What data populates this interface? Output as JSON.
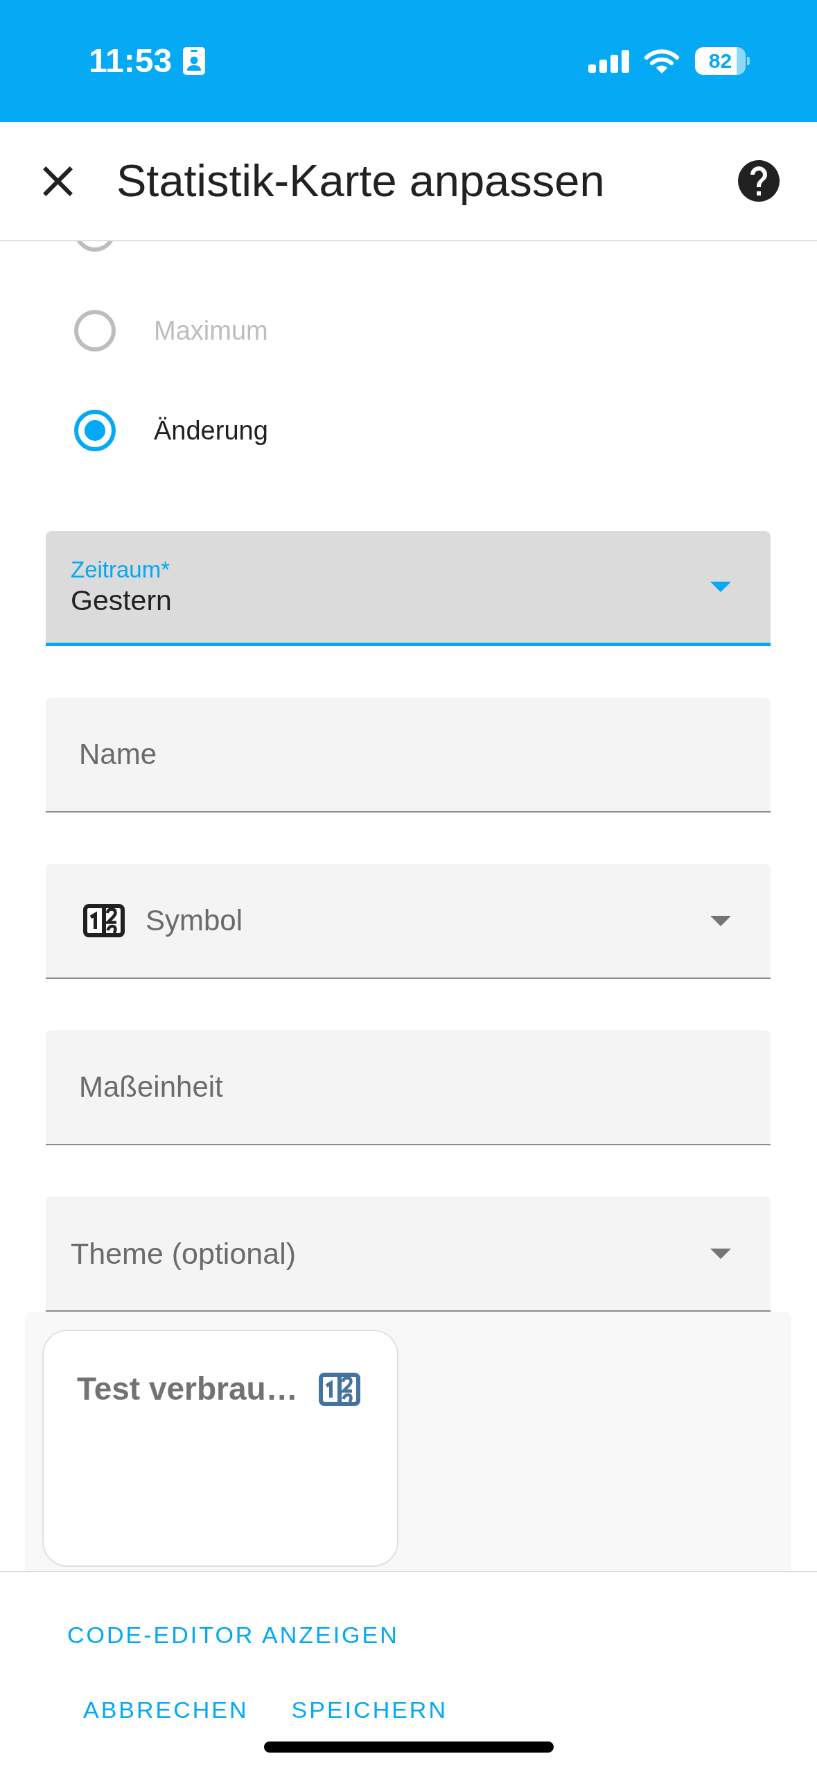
{
  "status_bar": {
    "time": "11:53",
    "battery": "82"
  },
  "header": {
    "title": "Statistik-Karte anpassen"
  },
  "stat_types": [
    {
      "selected": false,
      "disabled": true
    },
    {
      "label": "Maximum",
      "selected": false,
      "disabled": true
    },
    {
      "label": "Änderung",
      "selected": true,
      "disabled": false
    }
  ],
  "fields": [
    {
      "kind": "select",
      "label": "Zeitraum*",
      "value": "Gestern",
      "focused": true
    },
    {
      "kind": "text",
      "placeholder": "Name",
      "focused": false
    },
    {
      "kind": "icon_select",
      "placeholder": "Symbol",
      "focused": false
    },
    {
      "kind": "text",
      "placeholder": "Maßeinheit",
      "focused": false
    },
    {
      "kind": "select",
      "placeholder": "Theme (optional)",
      "focused": false
    }
  ],
  "preview": {
    "card_title": "Test verbrau…"
  },
  "actions": {
    "code_editor": "CODE-EDITOR ANZEIGEN",
    "buttons": [
      "ABBRECHEN",
      "SPEICHERN"
    ]
  }
}
